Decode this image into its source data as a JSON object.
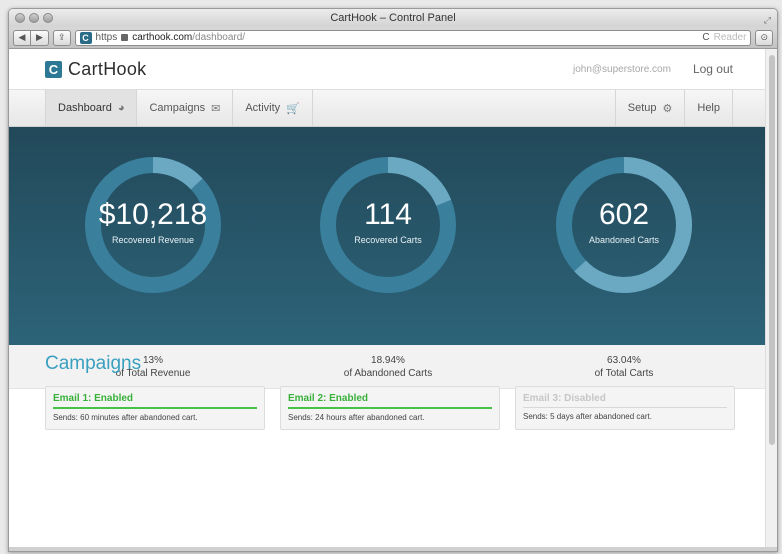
{
  "window": {
    "title": "CartHook – Control Panel"
  },
  "browser": {
    "back_label": "◀",
    "forward_label": "▶",
    "share_label": "⇪",
    "favicon": "C",
    "url_scheme": "https",
    "url_host": "carthook.com",
    "url_path": "/dashboard/",
    "reload_label": "C",
    "reader_label": "Reader",
    "downloads_icon": "downloads-icon"
  },
  "header": {
    "logo_mark": "C",
    "logo_text": "CartHook",
    "user_email": "john@superstore.com",
    "logout_label": "Log out"
  },
  "nav": {
    "dashboard": "Dashboard",
    "campaigns": "Campaigns",
    "activity": "Activity",
    "setup": "Setup",
    "help": "Help"
  },
  "metrics": [
    {
      "value": "$10,218",
      "label": "Recovered Revenue",
      "fraction": 0.13,
      "percent": "13%",
      "sub": "of Total Revenue"
    },
    {
      "value": "114",
      "label": "Recovered Carts",
      "fraction": 0.1894,
      "percent": "18.94%",
      "sub": "of Abandoned Carts"
    },
    {
      "value": "602",
      "label": "Abandoned Carts",
      "fraction": 0.6304,
      "percent": "63.04%",
      "sub": "of Total Carts"
    }
  ],
  "colors": {
    "ring_track": "#3a7f9c",
    "ring_fill": "#6ba8c2",
    "enabled": "#38b13a",
    "brand": "#2d7894"
  },
  "campaigns": {
    "title": "Campaigns",
    "items": [
      {
        "title": "Email 1: Enabled",
        "sub": "Sends: 60 minutes after abandoned cart."
      },
      {
        "title": "Email 2: Enabled",
        "sub": "Sends: 24 hours after abandoned cart."
      },
      {
        "title": "Email 3: Disabled",
        "sub": "Sends: 5 days after abandoned cart."
      }
    ]
  }
}
